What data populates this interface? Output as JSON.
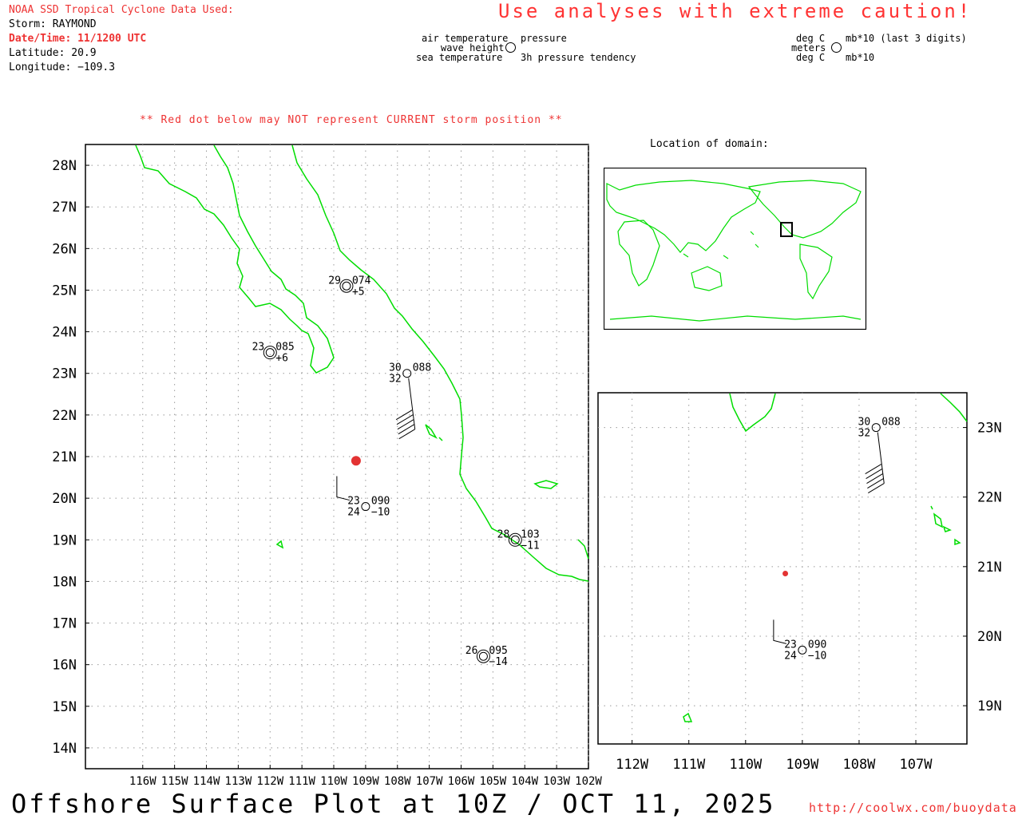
{
  "header": {
    "source": "NOAA SSD Tropical Cyclone Data Used:",
    "storm": "Storm: RAYMOND",
    "datetime": "Date/Time: 11/1200 UTC",
    "latitude": "Latitude: 20.9",
    "longitude": "Longitude: −109.3"
  },
  "caution": "Use analyses with extreme caution!",
  "legend_left": {
    "air_temperature": "air temperature",
    "wave_height": "wave height",
    "sea_temperature": "sea temperature",
    "pressure": "pressure",
    "pressure_tendency": "3h pressure tendency"
  },
  "legend_right": {
    "deg_c_top": "deg C",
    "meters": "meters",
    "deg_c_bottom": "deg C",
    "mb_top": "mb*10 (last 3 digits)",
    "mb_bottom": "mb*10"
  },
  "warning": "** Red dot below may NOT represent CURRENT storm position **",
  "location_title": "Location of domain:",
  "main_map": {
    "lat_labels": [
      "28N",
      "27N",
      "26N",
      "25N",
      "24N",
      "23N",
      "22N",
      "21N",
      "20N",
      "19N",
      "18N",
      "17N",
      "16N",
      "15N",
      "14N"
    ],
    "lon_labels": [
      "116W",
      "115W",
      "114W",
      "113W",
      "112W",
      "111W",
      "110W",
      "109W",
      "108W",
      "107W",
      "106W",
      "105W",
      "104W",
      "103W",
      "102W"
    ]
  },
  "inset_map": {
    "lat_labels": [
      "23N",
      "22N",
      "21N",
      "20N",
      "19N"
    ],
    "lon_labels": [
      "112W",
      "111W",
      "110W",
      "109W",
      "108W",
      "107W"
    ]
  },
  "storm_position": {
    "lat": 20.9,
    "lon": -109.3
  },
  "stations": [
    {
      "air": "29",
      "pressure": "074",
      "tendency": "+5",
      "sea": "",
      "lat": 25.1,
      "lon": -109.6
    },
    {
      "air": "23",
      "pressure": "085",
      "tendency": "+6",
      "sea": "",
      "lat": 23.5,
      "lon": -112.0
    },
    {
      "air": "30",
      "pressure": "088",
      "tendency": "",
      "sea": "32",
      "lat": 23.0,
      "lon": -107.7
    },
    {
      "air": "23",
      "pressure": "090",
      "tendency": "−10",
      "sea": "24",
      "lat": 19.8,
      "lon": -109.0
    },
    {
      "air": "28",
      "pressure": "103",
      "tendency": "−11",
      "sea": "",
      "lat": 19.0,
      "lon": -104.3
    },
    {
      "air": "26",
      "pressure": "095",
      "tendency": "−14",
      "sea": "",
      "lat": 16.2,
      "lon": -105.3
    }
  ],
  "footer": {
    "title": "Offshore Surface Plot at 10Z / OCT 11, 2025",
    "url": "http://coolwx.com/buoydata"
  },
  "colors": {
    "coast": "#00dd00",
    "storm": "#e33333",
    "grid": "#999999"
  }
}
